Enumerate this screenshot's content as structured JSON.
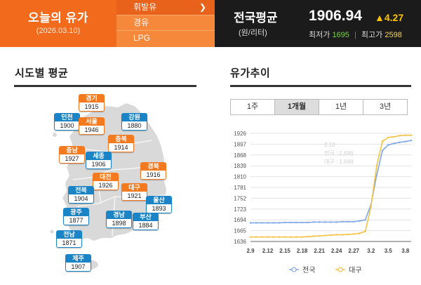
{
  "header": {
    "title": "오늘의 유가",
    "date": "(2026.03.10)",
    "fuel_tabs": [
      "휘발유",
      "경유",
      "LPG"
    ],
    "active_fuel": 0,
    "chevron_icon": "chevron-right-icon",
    "national_label": "전국평균",
    "national_unit": "(원/리터)",
    "national_avg": "1906.94",
    "change": "▲4.27",
    "min_label": "최저가",
    "min_value": "1695",
    "max_label": "최고가",
    "max_value": "2598",
    "colors": {
      "orange": "#f26b1d",
      "dark": "#1b1b1b",
      "up": "#ffc400"
    }
  },
  "regions_section": {
    "title": "시도별 평균"
  },
  "trend_section": {
    "title": "유가추이"
  },
  "regions": [
    {
      "name": "경기",
      "value": "1915",
      "color": "orange"
    },
    {
      "name": "인천",
      "value": "1900",
      "color": "blue"
    },
    {
      "name": "서울",
      "value": "1946",
      "color": "orange"
    },
    {
      "name": "강원",
      "value": "1880",
      "color": "blue"
    },
    {
      "name": "충북",
      "value": "1914",
      "color": "orange"
    },
    {
      "name": "충남",
      "value": "1927",
      "color": "orange"
    },
    {
      "name": "세종",
      "value": "1906",
      "color": "blue"
    },
    {
      "name": "경북",
      "value": "1916",
      "color": "orange"
    },
    {
      "name": "대전",
      "value": "1926",
      "color": "orange"
    },
    {
      "name": "전북",
      "value": "1904",
      "color": "blue"
    },
    {
      "name": "대구",
      "value": "1921",
      "color": "orange"
    },
    {
      "name": "울산",
      "value": "1893",
      "color": "blue"
    },
    {
      "name": "광주",
      "value": "1877",
      "color": "blue"
    },
    {
      "name": "경남",
      "value": "1898",
      "color": "blue"
    },
    {
      "name": "부산",
      "value": "1884",
      "color": "blue"
    },
    {
      "name": "전남",
      "value": "1871",
      "color": "blue"
    },
    {
      "name": "제주",
      "value": "1907",
      "color": "blue"
    }
  ],
  "period_tabs": [
    "1주",
    "1개월",
    "1년",
    "3년"
  ],
  "active_period": 1,
  "chart_data": {
    "type": "line",
    "x_ticks": [
      "2.9",
      "2.12",
      "2.15",
      "2.18",
      "2.21",
      "2.24",
      "2.27",
      "3.2",
      "3.5",
      "3.8"
    ],
    "y_ticks": [
      1636,
      1665,
      1694,
      1723,
      1752,
      1781,
      1810,
      1839,
      1868,
      1897,
      1926
    ],
    "ylim": [
      1636,
      1926
    ],
    "x_range": [
      0,
      28
    ],
    "grid": true,
    "legend": "bottom",
    "tooltip_faint": [
      "2.10",
      "전국 : 1,686",
      "대구 : 1,648"
    ],
    "series": [
      {
        "name": "전국",
        "color": "#7fa6e6",
        "x": [
          0,
          1,
          2,
          3,
          4,
          5,
          6,
          7,
          8,
          9,
          10,
          11,
          12,
          13,
          14,
          15,
          16,
          17,
          18,
          19,
          20,
          21,
          22,
          23,
          24,
          25,
          26,
          27,
          28
        ],
        "values": [
          1686,
          1686,
          1686,
          1686,
          1686,
          1686,
          1687,
          1687,
          1687,
          1687,
          1687,
          1688,
          1688,
          1688,
          1688,
          1688,
          1689,
          1689,
          1689,
          1691,
          1694,
          1735,
          1815,
          1880,
          1895,
          1899,
          1902,
          1904,
          1907
        ]
      },
      {
        "name": "대구",
        "color": "#f5c242",
        "x": [
          0,
          1,
          2,
          3,
          4,
          5,
          6,
          7,
          8,
          9,
          10,
          11,
          12,
          13,
          14,
          15,
          16,
          17,
          18,
          19,
          20,
          21,
          22,
          23,
          24,
          25,
          26,
          27,
          28
        ],
        "values": [
          1648,
          1648,
          1648,
          1648,
          1648,
          1648,
          1648,
          1648,
          1648,
          1648,
          1649,
          1650,
          1651,
          1652,
          1653,
          1654,
          1654,
          1655,
          1656,
          1658,
          1663,
          1730,
          1840,
          1905,
          1915,
          1917,
          1920,
          1921,
          1921
        ]
      }
    ]
  }
}
